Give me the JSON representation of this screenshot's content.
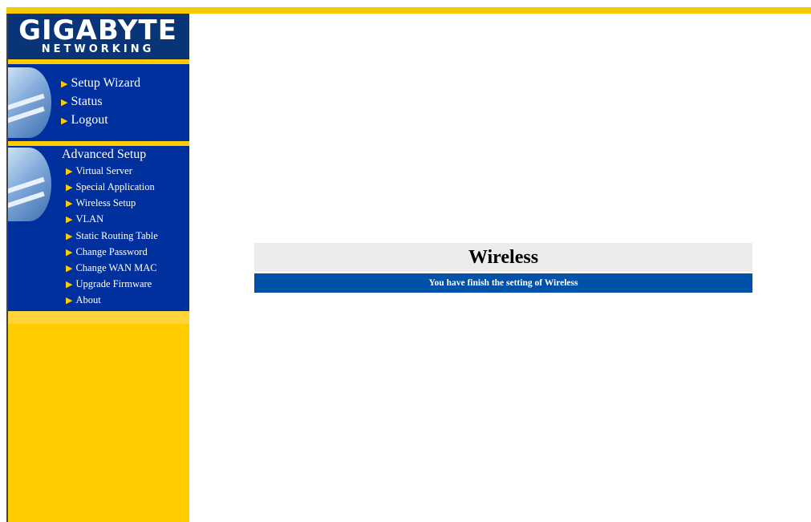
{
  "brand": {
    "name": "GIGABYTE",
    "tagline": "NETWORKING"
  },
  "sidebar": {
    "top_items": [
      {
        "label": "Setup Wizard",
        "icon": "arrow-right-icon"
      },
      {
        "label": "Status",
        "icon": "arrow-right-icon"
      },
      {
        "label": "Logout",
        "icon": "arrow-right-icon"
      }
    ],
    "advanced": {
      "title": "Advanced Setup",
      "items": [
        {
          "label": "Virtual Server"
        },
        {
          "label": "Special Application"
        },
        {
          "label": "Wireless Setup"
        },
        {
          "label": "VLAN"
        },
        {
          "label": "Static Routing Table"
        },
        {
          "label": "Change Password"
        },
        {
          "label": "Change WAN MAC"
        },
        {
          "label": "Upgrade Firmware"
        },
        {
          "label": "About"
        }
      ]
    }
  },
  "main": {
    "title": "Wireless",
    "message": "You have finish the setting of Wireless"
  },
  "colors": {
    "brand_blue": "#0a3478",
    "nav_blue": "#00309e",
    "accent_yellow": "#ffcc00",
    "message_blue": "#0052a8"
  }
}
